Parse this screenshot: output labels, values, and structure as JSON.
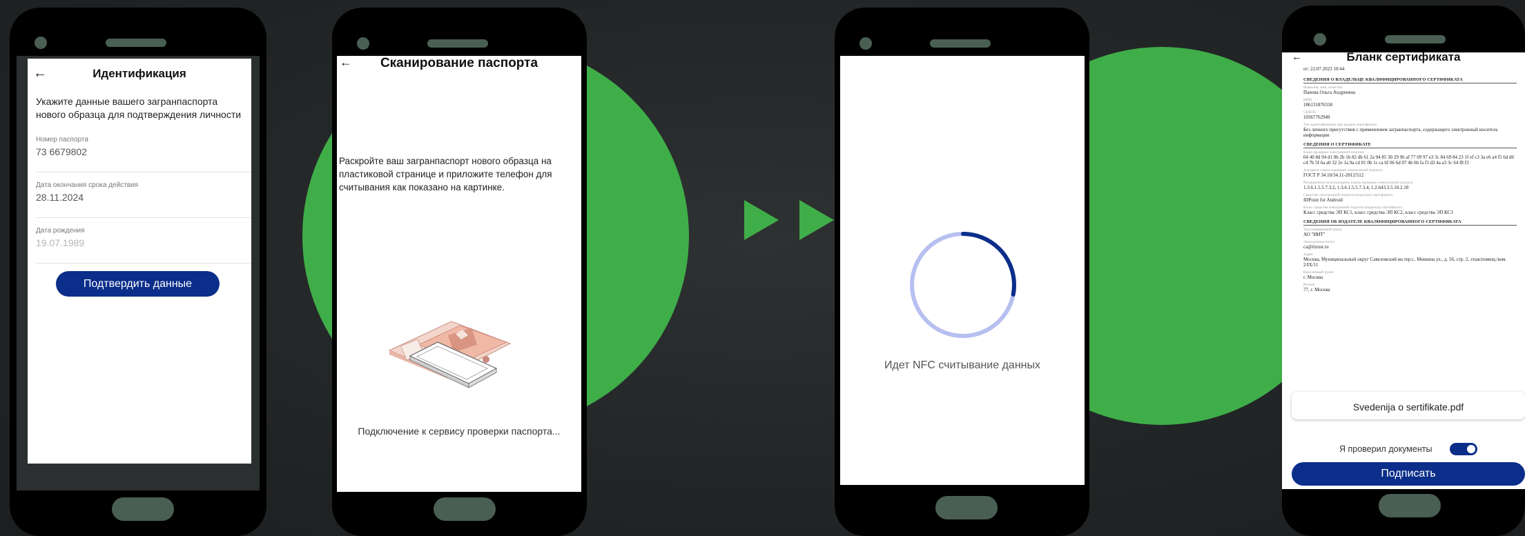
{
  "colors": {
    "accent_green": "#3fae49",
    "primary_blue": "#0b2e8a",
    "phone_body": "#000000",
    "phone_details": "#4a5f53"
  },
  "screen1": {
    "back_icon": "arrow-left-icon",
    "title": "Идентификация",
    "description": "Укажите данные вашего загранпаспорта нового образца для подтверждения личности",
    "fields": [
      {
        "label": "Номер паспорта",
        "value": "73 6679802"
      },
      {
        "label": "Дата окончания срока действия",
        "value": "28.11.2024"
      },
      {
        "label": "Дата рождения",
        "value": "19.07.1989"
      }
    ],
    "confirm_button": "Подтвердить данные"
  },
  "screen2": {
    "back_icon": "arrow-left-icon",
    "title": "Сканирование паспорта",
    "instruction": "Раскройте ваш загранпаспорт нового образца на пластиковой странице и приложите телефон для считывания как показано на картинке.",
    "status": "Подключение к сервису проверки паспорта..."
  },
  "screen3": {
    "status": "Идет NFC считывание данных",
    "progress_fraction": 0.28
  },
  "screen4": {
    "back_icon": "arrow-left-icon",
    "title": "Бланк сертификата",
    "header_line": "от: 22.07.2023 10:44",
    "sections": [
      {
        "heading": "СВЕДЕНИЯ О ВЛАДЕЛЬЦЕ КВАЛИФИЦИРОВАННОГО СЕРТИФИКАТА",
        "rows": [
          {
            "label": "Фамилия, имя, отчество",
            "value": "Панова Ольга Андреевна"
          },
          {
            "label": "ИНН",
            "value": "186131876558"
          },
          {
            "label": "СНИЛС",
            "value": "10367762949"
          },
          {
            "label": "Тип идентификации при выдаче сертификата",
            "value": "Без личного присутствия с применением загранпаспорта, содержащего электронный носитель информации"
          }
        ]
      },
      {
        "heading": "СВЕДЕНИЯ О СЕРТИФИКАТЕ",
        "rows": [
          {
            "label": "Ключ проверки электронной подписи",
            "value": "04 40 8d 94 d1 0b 2b 1b 82 db 61 2a 94 85 30 29 96 af 77 09 97 e3 3c 84 69 84 23 1f ef c3 3a e6 a4 f5 6d d6 c4 7b 5f 6a a0 32 2e 1a 9a cd 01 0b 1c ca 6f 06 6d 07 4b 6b fa f3 d3 4a a3 3c 64 f8 f3"
          },
          {
            "label": "Алгоритм ключа проверки электронной подписи",
            "value": "ГОСТ Р 34.10/34.11-2012/512"
          },
          {
            "label": "Расширенное использование ключа проверки электронной подписи",
            "value": "1.3.6.1.5.5.7.3.2, 1.3.6.1.5.5.7.3.4, 1.2.643.3.5.10.2.18"
          },
          {
            "label": "Средство электронной подписи владельца сертификата",
            "value": "IDPoint for Android"
          },
          {
            "label": "Класс средства электронной подписи владельца сертификата",
            "value": "Класс средства ЭП КС1, класс средства ЭП КС2, класс средства ЭП КС3"
          }
        ]
      },
      {
        "heading": "СВЕДЕНИЯ ОБ ИЗДАТЕЛЕ КВАЛИФИЦИРОВАННОГО СЕРТИФИКАТА",
        "rows": [
          {
            "label": "Удостоверяющий центр",
            "value": "АО \"ИИТ\""
          },
          {
            "label": "Электронная почта",
            "value": "ca@iitrust.ru"
          },
          {
            "label": "Адрес",
            "value": "Москва, Муниципальный округ Савеловский вн.тер.г., Мишина ул., д. 56, стр. 2, этаж/помещ./ком. 2/IX/11"
          },
          {
            "label": "Населенный пункт",
            "value": "г. Москва"
          },
          {
            "label": "Регион",
            "value": "77, г. Москва"
          }
        ]
      }
    ],
    "file_name": "Svedenija o sertifikate.pdf",
    "checkbox_label": "Я проверил документы",
    "toggle_on": true,
    "sign_button": "Подписать"
  }
}
